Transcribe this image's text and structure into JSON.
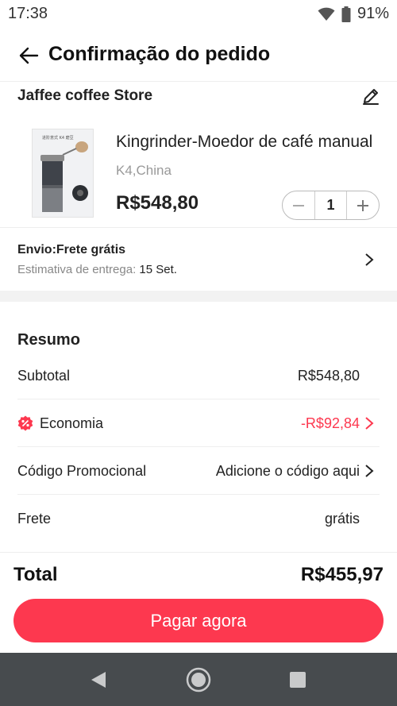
{
  "status_bar": {
    "time": "17:38",
    "battery": "91%"
  },
  "header": {
    "title": "Confirmação do pedido"
  },
  "store": {
    "name": "Jaffee coffee Store"
  },
  "product": {
    "name": "Kingrinder-Moedor de café manual",
    "variant": "K4,China",
    "price": "R$548,80",
    "quantity": "1",
    "thumb_caption": "进阶意式 K4 磨豆"
  },
  "shipping": {
    "title": "Envio:Frete grátis",
    "estimate_label": "Estimativa de entrega:",
    "estimate_date": "15 Set."
  },
  "summary": {
    "title": "Resumo",
    "subtotal_label": "Subtotal",
    "subtotal_value": "R$548,80",
    "discount_label": "Economia",
    "discount_value": "-R$92,84",
    "promo_label": "Código Promocional",
    "promo_value": "Adicione o código aqui",
    "freight_label": "Frete",
    "freight_value": "grátis"
  },
  "total": {
    "label": "Total",
    "value": "R$455,97"
  },
  "pay_button": {
    "label": "Pagar agora"
  },
  "colors": {
    "accent": "#fd384f",
    "navbar": "#474b4e"
  },
  "icons": [
    "back-arrow-icon",
    "edit-pencil-icon",
    "minus-icon",
    "plus-icon",
    "chevron-right-icon",
    "discount-badge-icon",
    "wifi-icon",
    "battery-icon",
    "nav-back-icon",
    "nav-home-icon",
    "nav-recents-icon"
  ]
}
